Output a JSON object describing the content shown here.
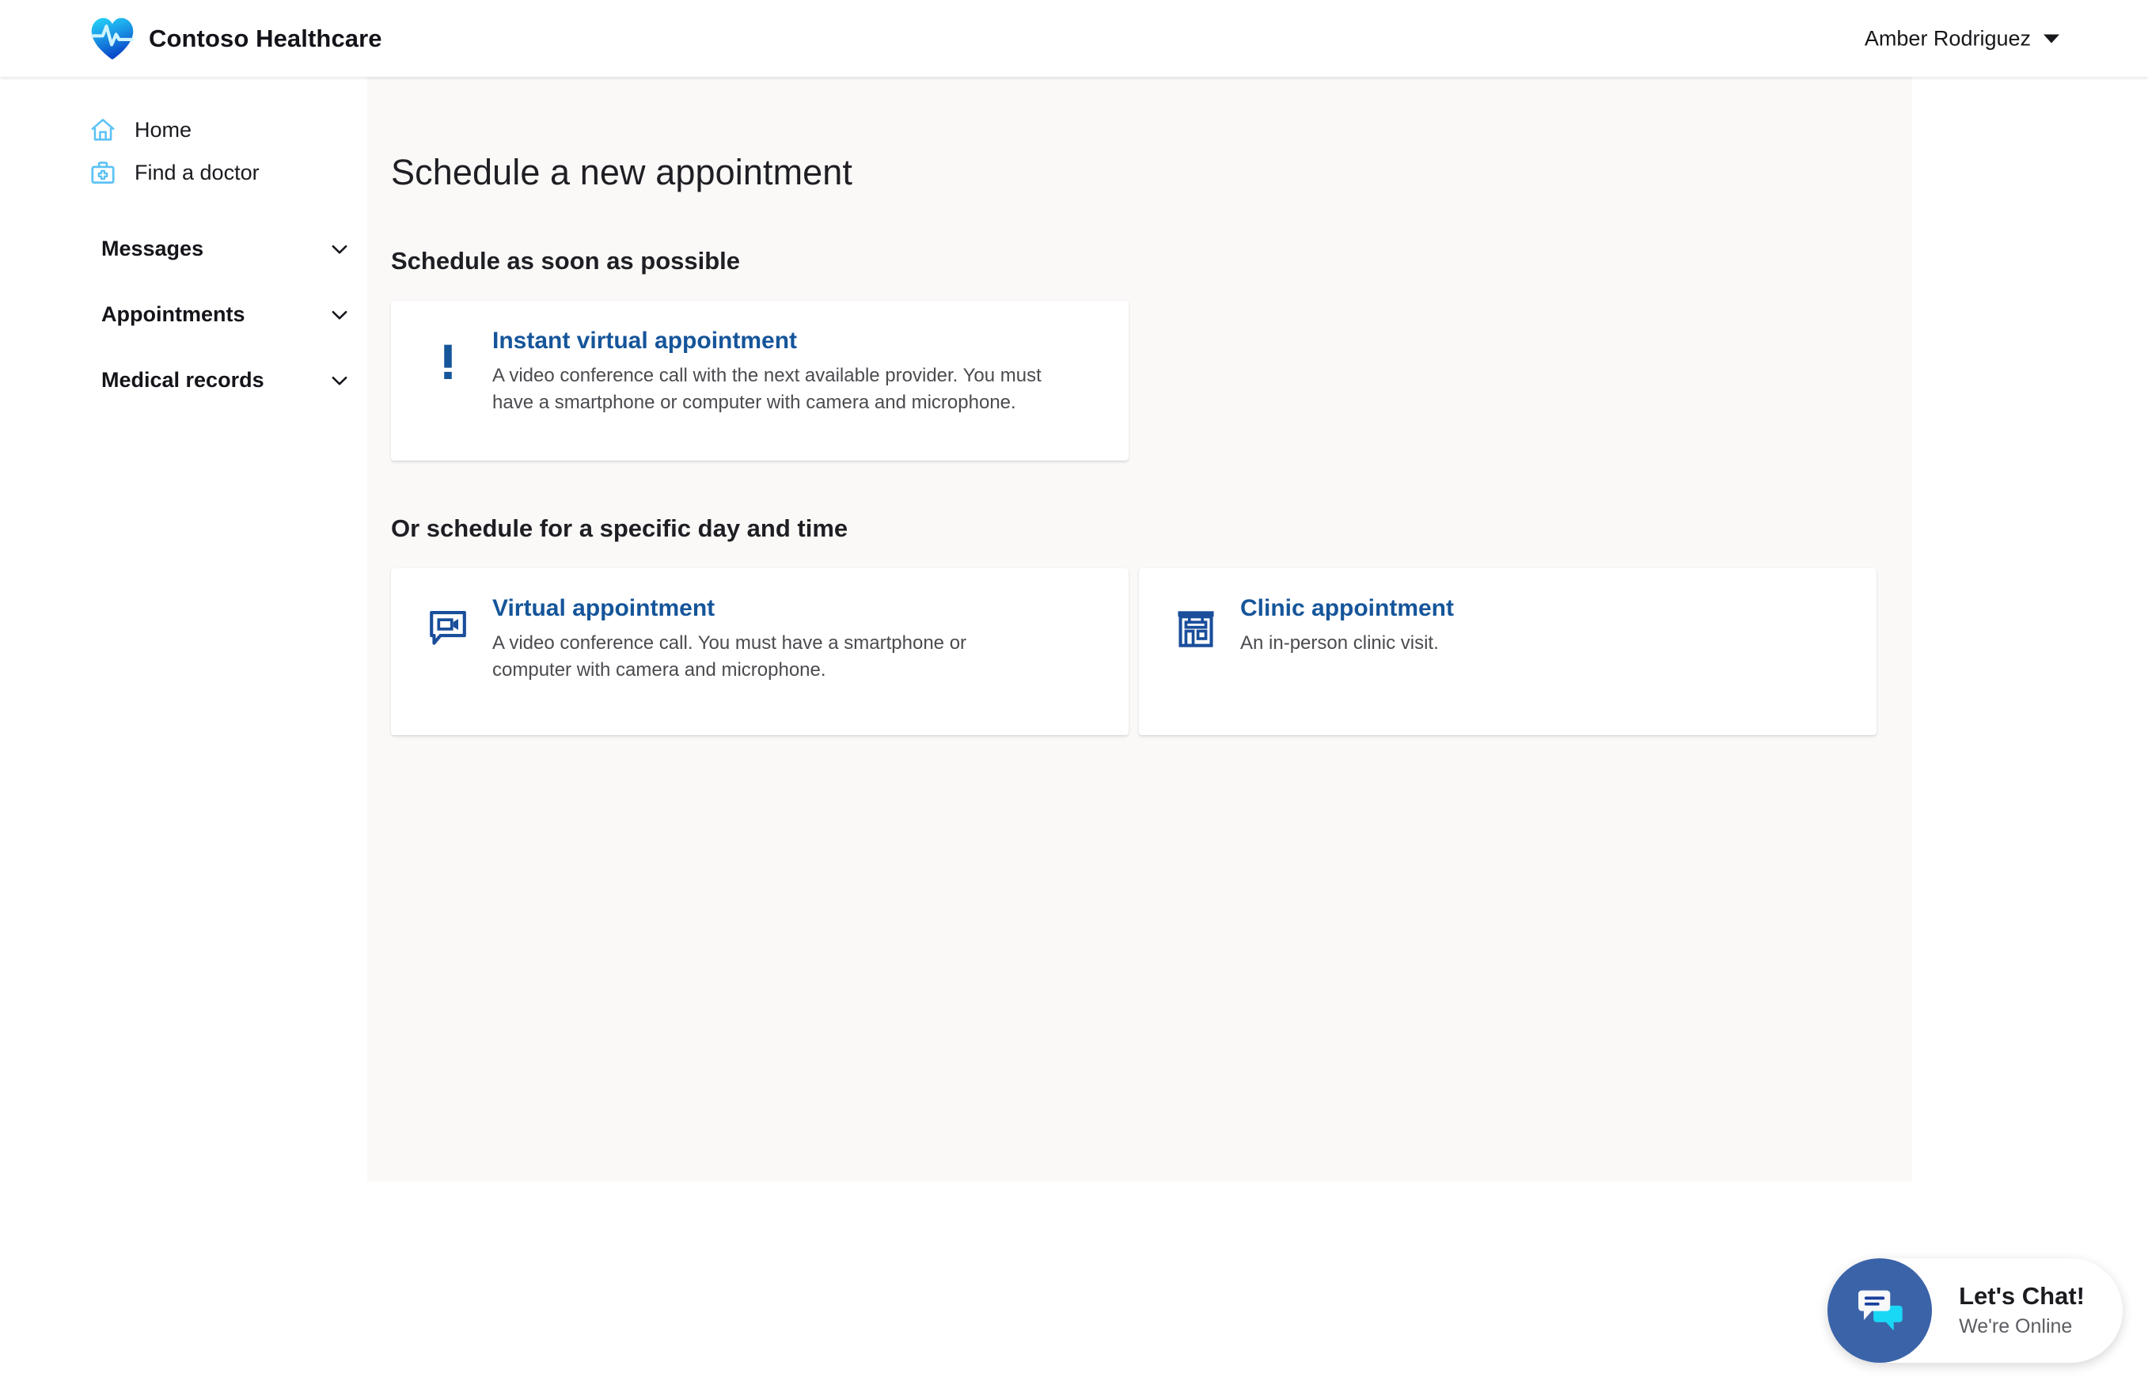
{
  "header": {
    "brand_name": "Contoso Healthcare",
    "logo_icon": "heart-pulse-logo",
    "user_name": "Amber Rodriguez",
    "caret_icon": "chevron-down-icon"
  },
  "sidebar": {
    "links": [
      {
        "label": "Home",
        "icon": "home-icon"
      },
      {
        "label": "Find a doctor",
        "icon": "medical-bag-icon"
      }
    ],
    "sections": [
      {
        "label": "Messages",
        "icon": "chevron-down-icon"
      },
      {
        "label": "Appointments",
        "icon": "chevron-down-icon"
      },
      {
        "label": "Medical records",
        "icon": "chevron-down-icon"
      }
    ]
  },
  "main": {
    "page_title": "Schedule a new appointment",
    "sections": [
      {
        "heading": "Schedule as soon as possible",
        "cards": [
          {
            "title": "Instant virtual appointment",
            "description": "A video conference call with the next available provider. You must have a smartphone or computer with camera and microphone.",
            "icon": "exclamation-icon"
          }
        ]
      },
      {
        "heading": "Or schedule for a specific day and time",
        "cards": [
          {
            "title": "Virtual appointment",
            "description": "A video conference call. You must have a smartphone or computer with camera and microphone.",
            "icon": "video-chat-icon"
          },
          {
            "title": "Clinic appointment",
            "description": "An in-person clinic visit.",
            "icon": "clinic-building-icon"
          }
        ]
      }
    ]
  },
  "chat": {
    "title": "Let's Chat!",
    "status": "We're Online",
    "icon": "chat-bubbles-icon"
  },
  "colors": {
    "link_blue": "#15559a",
    "icon_blue": "#1a4e9b",
    "nav_icon_blue": "#5bc2f5",
    "canvas": "#faf9f8",
    "chat_avatar": "#3b63a8",
    "chat_bubble_cyan": "#19d8f5"
  }
}
